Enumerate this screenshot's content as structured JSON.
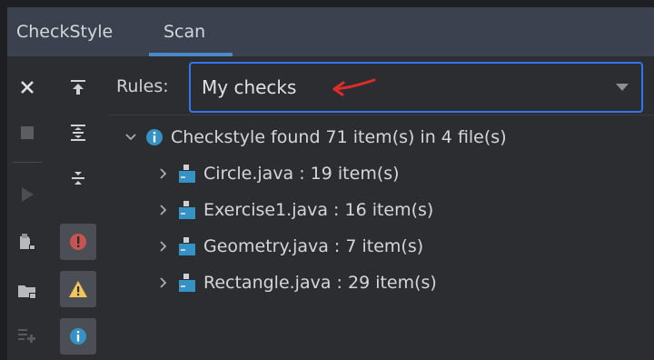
{
  "tabs": [
    {
      "label": "CheckStyle"
    },
    {
      "label": "Scan"
    }
  ],
  "rules": {
    "label": "Rules:",
    "selected": "My checks"
  },
  "tree": {
    "summary": "Checkstyle found 71 item(s) in 4 file(s)",
    "files": [
      {
        "label": "Circle.java : 19 item(s)"
      },
      {
        "label": "Exercise1.java : 16 item(s)"
      },
      {
        "label": "Geometry.java : 7 item(s)"
      },
      {
        "label": "Rectangle.java : 29 item(s)"
      }
    ]
  },
  "icons": {
    "close": "close-icon",
    "expand_all": "expand-all-icon",
    "stop": "stop-icon",
    "collapse_all": "collapse-all-icon",
    "run": "run-icon",
    "group_by_severity": "group-icon",
    "module_scan": "module-scan-icon",
    "error_filter": "error-icon",
    "folder_scan": "folder-scan-icon",
    "warning_filter": "warning-icon",
    "settings": "configure-icon",
    "info_filter": "info-icon"
  },
  "colors": {
    "accent": "#3574f0",
    "error": "#db5c5c",
    "warning": "#f2c55c",
    "info": "#3592c4",
    "annotation_arrow": "#e02b2b"
  }
}
